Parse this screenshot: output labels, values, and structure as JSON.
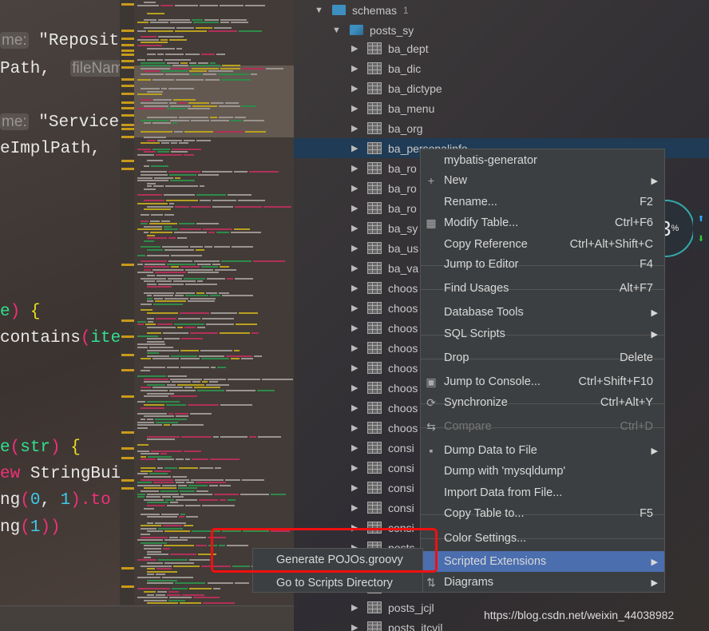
{
  "editor": {
    "lines": [
      {
        "hint": "me:",
        "text": " \"Reposit"
      },
      {
        "text": "Path,  ",
        "hint": "fileNam"
      },
      {
        "hint": "me:",
        "text": " \"Service"
      },
      {
        "text": "eImplPath,"
      },
      {
        "a": "e",
        "b": ")",
        "c": " {"
      },
      {
        "a": "contains",
        "b": "(",
        "c": "ite"
      },
      {
        "a": "e",
        "b": "(",
        "c": "str",
        "d": ")",
        "e": " {"
      },
      {
        "a": "ew",
        "b": " StringBui"
      },
      {
        "a": "ng",
        "b": "(",
        "c": "0",
        "d": ", ",
        "e": "1",
        "f": ").to"
      },
      {
        "a": "ng",
        "b": "(",
        "c": "1",
        "d": "))"
      }
    ]
  },
  "tree": {
    "schemas": {
      "label": "schemas",
      "count": "1"
    },
    "schema": "posts_sy",
    "tables": [
      "ba_dept",
      "ba_dic",
      "ba_dictype",
      "ba_menu",
      "ba_org",
      "ba_personalinfo",
      "ba_ro",
      "ba_ro",
      "ba_ro",
      "ba_sy",
      "ba_us",
      "ba_va",
      "choos",
      "choos",
      "choos",
      "choos",
      "choos",
      "choos",
      "choos",
      "choos",
      "consi",
      "consi",
      "consi",
      "consi",
      "consi",
      "posts",
      "",
      "",
      "posts_jcjl",
      "posts_itcvil"
    ],
    "selected": "ba_personalinfo"
  },
  "context_menu": {
    "items": [
      {
        "label": "mybatis-generator"
      },
      {
        "label": "New",
        "icon": "plus-icon",
        "submenu": true
      },
      {
        "label": "Rename...",
        "shortcut": "F2"
      },
      {
        "label": "Modify Table...",
        "shortcut": "Ctrl+F6",
        "icon": "table-icon"
      },
      {
        "label": "Copy Reference",
        "shortcut": "Ctrl+Alt+Shift+C"
      },
      {
        "label": "Jump to Editor",
        "shortcut": "F4"
      },
      {
        "label": "Find Usages",
        "shortcut": "Alt+F7"
      },
      {
        "label": "Database Tools",
        "submenu": true
      },
      {
        "label": "SQL Scripts",
        "submenu": true
      },
      {
        "label": "Drop",
        "shortcut": "Delete"
      },
      {
        "label": "Jump to Console...",
        "shortcut": "Ctrl+Shift+F10",
        "icon": "console-icon"
      },
      {
        "label": "Synchronize",
        "shortcut": "Ctrl+Alt+Y",
        "icon": "sync-icon"
      },
      {
        "label": "Compare",
        "shortcut": "Ctrl+D",
        "icon": "compare-icon",
        "disabled": true
      },
      {
        "label": "Dump Data to File",
        "icon": "save-icon",
        "submenu": true
      },
      {
        "label": "Dump with 'mysqldump'"
      },
      {
        "label": "Import Data from File..."
      },
      {
        "label": "Copy Table to...",
        "shortcut": "F5"
      },
      {
        "label": "Color Settings..."
      },
      {
        "label": "Scripted Extensions",
        "submenu": true,
        "highlighted": true
      },
      {
        "label": "Diagrams",
        "icon": "diagram-icon",
        "submenu": true
      }
    ]
  },
  "submenu": {
    "items": [
      "Generate POJOs.groovy",
      "Go to Scripts Directory"
    ]
  },
  "widget": {
    "value": "3",
    "unit": "%"
  },
  "watermark": "https://blog.csdn.net/weixin_44038982",
  "colors": {
    "highlight": "#4b6eaf",
    "selection": "#1f3b55",
    "annotation": "#f01010"
  }
}
